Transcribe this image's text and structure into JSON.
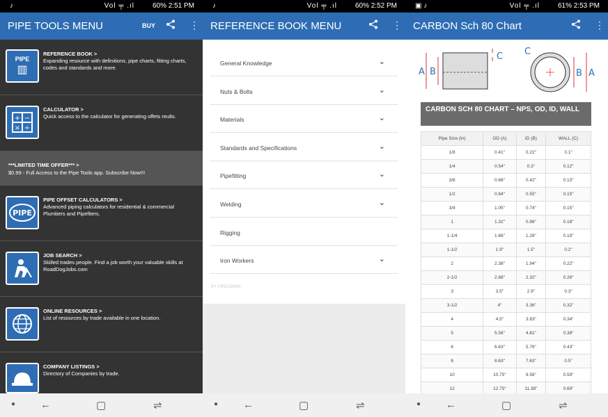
{
  "panels": [
    {
      "status": {
        "left": "♪",
        "signal": "Vol ╤ .ıl",
        "right": "60% 2:51 PM"
      },
      "title": "PIPE TOOLS MENU",
      "buy": "BUY"
    },
    {
      "status": {
        "left": "♪",
        "signal": "Vol ╤ .ıl",
        "right": "60% 2:52 PM"
      },
      "title": "REFERENCE BOOK MENU"
    },
    {
      "status": {
        "left": "▣ ♪",
        "signal": "Vol ╤ .ıl",
        "right": "61% 2:53 PM"
      },
      "title": "CARBON Sch 80 Chart"
    }
  ],
  "menu": [
    {
      "icon": "book-icon",
      "glyph": "📖",
      "badge": "PIPE",
      "title": "REFERENCE BOOK  >",
      "desc": "Expanding resource with definitions, pipe charts, fitting charts, codes and standards and more."
    },
    {
      "icon": "calculator-icon",
      "glyph": "⊞",
      "title": "CALCULATOR  >",
      "desc": "Quick access to the calculator for generating offets reults."
    },
    {
      "icon": "pipe-logo-icon",
      "glyph": "PIPE",
      "title": "PIPE OFFSET CALCULATORS  >",
      "desc": "Advanced piping calculators for residential & commercial Plumbers and Pipefiters."
    },
    {
      "icon": "worker-icon",
      "glyph": "⛏",
      "title": "JOB SEARCH  >",
      "desc": "Skilled trades people. Find a job worth your valuable skills at RoadDogJobs.com"
    },
    {
      "icon": "globe-icon",
      "glyph": "◍",
      "title": "ONLINE RESOURCES  >",
      "desc": "List of resources by trade available in one location."
    },
    {
      "icon": "hardhat-icon",
      "glyph": "⛑",
      "title": "COMPANY LISTINGS  >",
      "desc": "Directory of Companies by trade."
    }
  ],
  "offer": {
    "title": "***LIMITED TIME OFFER***  >",
    "desc": "$0.99 - Full Access to the Pipe Tools app. Subscribe Now!!!"
  },
  "reference": [
    "General Knowledge",
    "Nuts & Bolts",
    "Materials",
    "Standards and Specifications",
    "Pipefitting",
    "Welding",
    "Rigging",
    "Iron Workers"
  ],
  "reference_chev": [
    true,
    true,
    true,
    true,
    true,
    true,
    false,
    true
  ],
  "byline": "BY PIPEADMIN",
  "diagram": {
    "a": "A",
    "b": "B",
    "c": "C"
  },
  "chart_heading": "CARBON SCH 80 CHART – NPS, OD, ID, WALL",
  "table": {
    "headers": [
      "Pipe Size (In)",
      "OD (A)",
      "ID (B)",
      "WALL (C)"
    ],
    "rows": [
      [
        "1/8",
        "0.41\"",
        "0.22\"",
        "0.1\""
      ],
      [
        "1/4",
        "0.54\"",
        "0.3\"",
        "0.12\""
      ],
      [
        "3/8",
        "0.68\"",
        "0.42\"",
        "0.13\""
      ],
      [
        "1/2",
        "0.84\"",
        "0.55\"",
        "0.15\""
      ],
      [
        "3/4",
        "1.05\"",
        "0.74\"",
        "0.15\""
      ],
      [
        "1",
        "1.32\"",
        "0.96\"",
        "0.18\""
      ],
      [
        "1-1/4",
        "1.66\"",
        "1.28\"",
        "0.19\""
      ],
      [
        "1-1/2",
        "1.9\"",
        "1.5\"",
        "0.2\""
      ],
      [
        "2",
        "2.38\"",
        "1.94\"",
        "0.22\""
      ],
      [
        "2-1/2",
        "2.88\"",
        "2.32\"",
        "0.28\""
      ],
      [
        "3",
        "3.5\"",
        "2.9\"",
        "0.3\""
      ],
      [
        "3-1/2",
        "4\"",
        "3.36\"",
        "0.32\""
      ],
      [
        "4",
        "4.5\"",
        "3.83\"",
        "0.34\""
      ],
      [
        "5",
        "5.56\"",
        "4.81\"",
        "0.38\""
      ],
      [
        "6",
        "6.63\"",
        "5.76\"",
        "0.43\""
      ],
      [
        "8",
        "8.63\"",
        "7.63\"",
        "0.5\""
      ],
      [
        "10",
        "10.75\"",
        "9.56\"",
        "0.59\""
      ],
      [
        "12",
        "12.75\"",
        "11.38\"",
        "0.69\""
      ]
    ]
  },
  "colors": {
    "brand": "#2e6db4",
    "menu_bg": "#333333",
    "diagram_red": "#e03030"
  }
}
